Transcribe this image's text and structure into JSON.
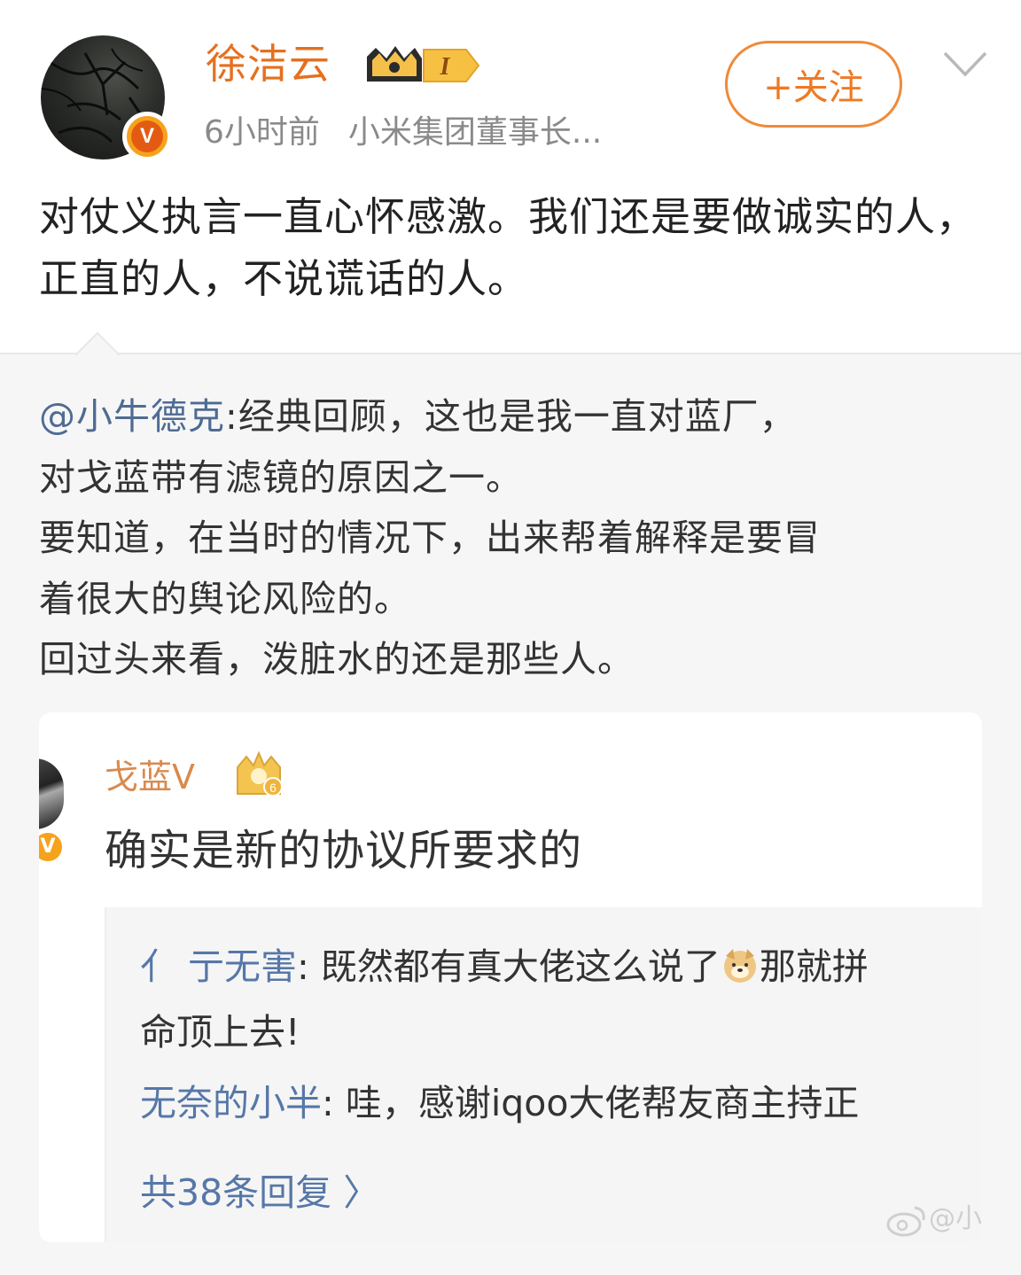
{
  "post": {
    "username": "徐洁云",
    "vip_level": "I",
    "time": "6小时前",
    "source": "小米集团董事长...",
    "follow_label": "+关注",
    "text": "对仗义执言一直心怀感激。我们还是要做诚实的人，正直的人，不说谎话的人。"
  },
  "repost": {
    "mention": "@小牛德克",
    "lines": [
      ":经典回顾，这也是我一直对蓝厂，",
      "对戈蓝带有滤镜的原因之一。",
      "要知道，在当时的情况下，出来帮着解释是要冒",
      "着很大的舆论风险的。",
      "回过头来看，泼脏水的还是那些人。"
    ]
  },
  "embedded": {
    "username": "戈蓝V",
    "badge_level": "6",
    "comment": "确实是新的协议所要求的",
    "replies": [
      {
        "name": "亻 亍无害",
        "text_before": ": 既然都有真大佬这么说了",
        "text_after": "那就拼",
        "line2": "命顶上去!"
      },
      {
        "name": "无奈的小半",
        "text_before": ": 哇，感谢iqoo大佬帮友商主持正",
        "text_after": "",
        "line2": ""
      }
    ],
    "more_replies": "共38条回复 〉"
  },
  "watermark": "@小"
}
